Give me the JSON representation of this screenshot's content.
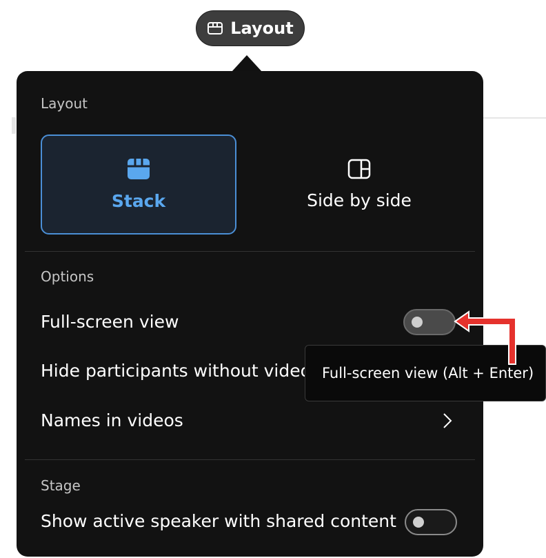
{
  "layout_button": {
    "label": "Layout",
    "icon": "window-icon"
  },
  "panel": {
    "layout_section": {
      "title": "Layout",
      "options": [
        {
          "label": "Stack",
          "icon": "stack-icon",
          "selected": true
        },
        {
          "label": "Side by side",
          "icon": "side-by-side-icon",
          "selected": false
        }
      ]
    },
    "options_section": {
      "title": "Options",
      "full_screen": {
        "label": "Full-screen view",
        "enabled": false
      },
      "hide_participants": {
        "label": "Hide participants without video"
      },
      "names_in_videos": {
        "label": "Names in videos",
        "icon": "chevron-right-icon"
      }
    },
    "stage_section": {
      "title": "Stage",
      "active_speaker": {
        "label": "Show active speaker with shared content",
        "enabled": false
      }
    }
  },
  "tooltip": {
    "text": "Full-screen view (Alt + Enter)"
  },
  "colors": {
    "panel_bg": "#121212",
    "accent": "#5aa7ee",
    "selected_border": "#4b8fd6",
    "annotation": "#e5322d"
  }
}
